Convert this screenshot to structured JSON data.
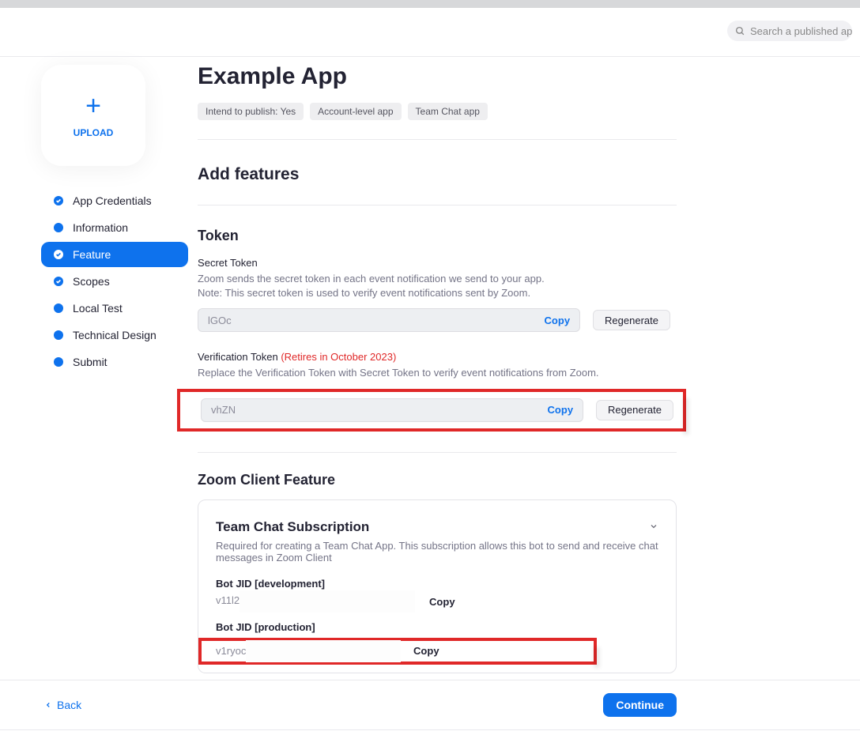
{
  "search": {
    "placeholder": "Search a published app"
  },
  "sidebar": {
    "upload_label": "UPLOAD",
    "items": [
      {
        "label": "App Credentials",
        "type": "check"
      },
      {
        "label": "Information",
        "type": "dot"
      },
      {
        "label": "Feature",
        "type": "check",
        "active": true
      },
      {
        "label": "Scopes",
        "type": "check"
      },
      {
        "label": "Local Test",
        "type": "dot"
      },
      {
        "label": "Technical Design",
        "type": "dot"
      },
      {
        "label": "Submit",
        "type": "dot"
      }
    ]
  },
  "app": {
    "title": "Example App",
    "tags": [
      "Intend to publish: Yes",
      "Account-level app",
      "Team Chat app"
    ]
  },
  "sections": {
    "add_features_title": "Add features",
    "token_title": "Token",
    "secret": {
      "label": "Secret Token",
      "desc1": "Zoom sends the secret token in each event notification we send to your app.",
      "desc2": "Note: This secret token is used to verify event notifications sent by Zoom.",
      "value": "lGOc",
      "copy": "Copy",
      "regen": "Regenerate"
    },
    "verification": {
      "label": "Verification Token ",
      "retires": "(Retires in October 2023)",
      "desc": "Replace the Verification Token with Secret Token to verify event notifications from Zoom.",
      "value": "vhZN",
      "copy": "Copy",
      "regen": "Regenerate"
    },
    "client_title": "Zoom Client Feature",
    "team_chat": {
      "title": "Team Chat Subscription",
      "desc": "Required for creating a Team Chat App. This subscription allows this bot to send and receive chat messages in Zoom Client",
      "dev_label": "Bot JID [development]",
      "dev_value": "v11l2",
      "dev_copy": "Copy",
      "prod_label": "Bot JID [production]",
      "prod_value": "v1ryoc",
      "prod_copy": "Copy"
    }
  },
  "footer": {
    "back": "Back",
    "continue": "Continue"
  }
}
